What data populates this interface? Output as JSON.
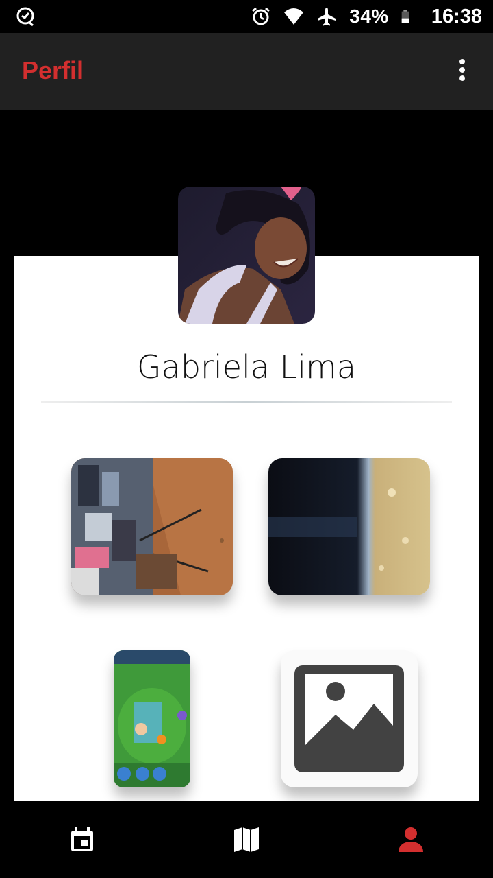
{
  "status_bar": {
    "left_icon": "quick-actions-icon",
    "icons": [
      "alarm-icon",
      "wifi-icon",
      "airplane-icon",
      "battery-icon"
    ],
    "battery": "34%",
    "time": "16:38"
  },
  "app_bar": {
    "title": "Perfil",
    "overflow_icon": "more-vert-icon",
    "title_color": "#d32f2f"
  },
  "profile": {
    "name": "Gabriela Lima"
  },
  "photos": [
    {
      "name": "photo-crowd-outdoor"
    },
    {
      "name": "photo-water-dark"
    },
    {
      "name": "photo-game-screenshot"
    },
    {
      "name": "photo-placeholder",
      "icon": "image-placeholder-icon"
    }
  ],
  "bottom_nav": [
    {
      "icon": "calendar-icon",
      "active": false
    },
    {
      "icon": "map-icon",
      "active": false
    },
    {
      "icon": "person-icon",
      "active": true
    }
  ],
  "colors": {
    "accent": "#d32f2f",
    "appbar_bg": "#212121",
    "background": "#000000",
    "card_bg": "#ffffff"
  }
}
